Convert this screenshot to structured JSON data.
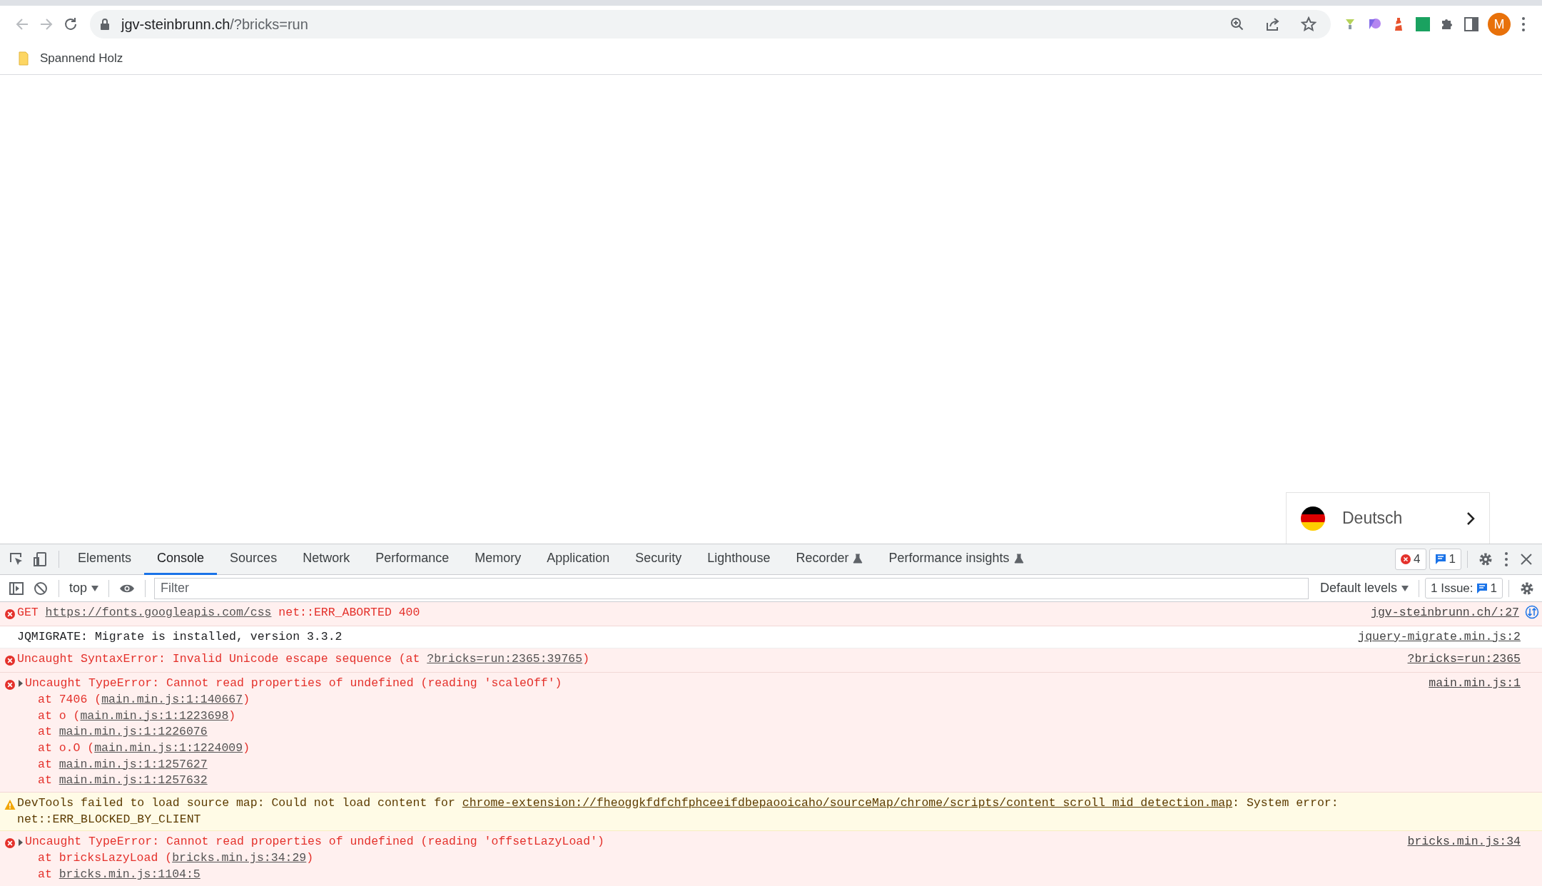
{
  "browser": {
    "url_host": "jgv-steinbrunn.ch",
    "url_path": "/?bricks=run",
    "profile_initial": "M",
    "bookmarks": [
      {
        "label": "Spannend Holz"
      }
    ]
  },
  "page": {
    "language_switcher": {
      "label": "Deutsch"
    }
  },
  "devtools": {
    "tabs": [
      {
        "label": "Elements",
        "selected": false,
        "experimental": false
      },
      {
        "label": "Console",
        "selected": true,
        "experimental": false
      },
      {
        "label": "Sources",
        "selected": false,
        "experimental": false
      },
      {
        "label": "Network",
        "selected": false,
        "experimental": false
      },
      {
        "label": "Performance",
        "selected": false,
        "experimental": false
      },
      {
        "label": "Memory",
        "selected": false,
        "experimental": false
      },
      {
        "label": "Application",
        "selected": false,
        "experimental": false
      },
      {
        "label": "Security",
        "selected": false,
        "experimental": false
      },
      {
        "label": "Lighthouse",
        "selected": false,
        "experimental": false
      },
      {
        "label": "Recorder",
        "selected": false,
        "experimental": true
      },
      {
        "label": "Performance insights",
        "selected": false,
        "experimental": true
      }
    ],
    "error_count": "4",
    "message_count": "1",
    "console_toolbar": {
      "context": "top",
      "filter_placeholder": "Filter",
      "levels": "Default levels",
      "issues_label": "1 Issue:",
      "issues_count": "1"
    },
    "messages": [
      {
        "kind": "error",
        "lines": [
          [
            {
              "text": "GET "
            },
            {
              "text": "https://fonts.googleapis.com/css",
              "link": true
            },
            {
              "text": " net::ERR_ABORTED 400"
            }
          ]
        ],
        "source": "jgv-steinbrunn.ch/:27",
        "network_request": true
      },
      {
        "kind": "info",
        "lines": [
          [
            {
              "text": "JQMIGRATE: Migrate is installed, version 3.3.2"
            }
          ]
        ],
        "source": "jquery-migrate.min.js:2"
      },
      {
        "kind": "error",
        "lines": [
          [
            {
              "text": "Uncaught SyntaxError: Invalid Unicode escape sequence (at "
            },
            {
              "text": "?bricks=run:2365:39765",
              "link": true
            },
            {
              "text": ")"
            }
          ]
        ],
        "source": "?bricks=run:2365"
      },
      {
        "kind": "error",
        "expanded": false,
        "lines": [
          [
            {
              "text": "Uncaught TypeError: Cannot read properties of undefined (reading 'scaleOff')"
            }
          ]
        ],
        "stack": [
          [
            {
              "text": "at 7406 ("
            },
            {
              "text": "main.min.js:1:140667",
              "link": true
            },
            {
              "text": ")"
            }
          ],
          [
            {
              "text": "at o ("
            },
            {
              "text": "main.min.js:1:1223698",
              "link": true
            },
            {
              "text": ")"
            }
          ],
          [
            {
              "text": "at "
            },
            {
              "text": "main.min.js:1:1226076",
              "link": true
            }
          ],
          [
            {
              "text": "at o.O ("
            },
            {
              "text": "main.min.js:1:1224009",
              "link": true
            },
            {
              "text": ")"
            }
          ],
          [
            {
              "text": "at "
            },
            {
              "text": "main.min.js:1:1257627",
              "link": true
            }
          ],
          [
            {
              "text": "at "
            },
            {
              "text": "main.min.js:1:1257632",
              "link": true
            }
          ]
        ],
        "source": "main.min.js:1"
      },
      {
        "kind": "warning",
        "lines": [
          [
            {
              "text": "DevTools failed to load source map: Could not load content for "
            },
            {
              "text": "chrome-extension://fheoggkfdfchfphceeifdbepaooicaho/sourceMap/chrome/scripts/content_scroll_mid_detection.map",
              "link": true
            },
            {
              "text": ": System error:"
            }
          ],
          [
            {
              "text": "net::ERR_BLOCKED_BY_CLIENT"
            }
          ]
        ]
      },
      {
        "kind": "error",
        "expanded": false,
        "lines": [
          [
            {
              "text": "Uncaught TypeError: Cannot read properties of undefined (reading 'offsetLazyLoad')"
            }
          ]
        ],
        "stack": [
          [
            {
              "text": "at bricksLazyLoad ("
            },
            {
              "text": "bricks.min.js:34:29",
              "link": true
            },
            {
              "text": ")"
            }
          ],
          [
            {
              "text": "at "
            },
            {
              "text": "bricks.min.js:1104:5",
              "link": true
            }
          ]
        ],
        "source": "bricks.min.js:34"
      }
    ]
  }
}
